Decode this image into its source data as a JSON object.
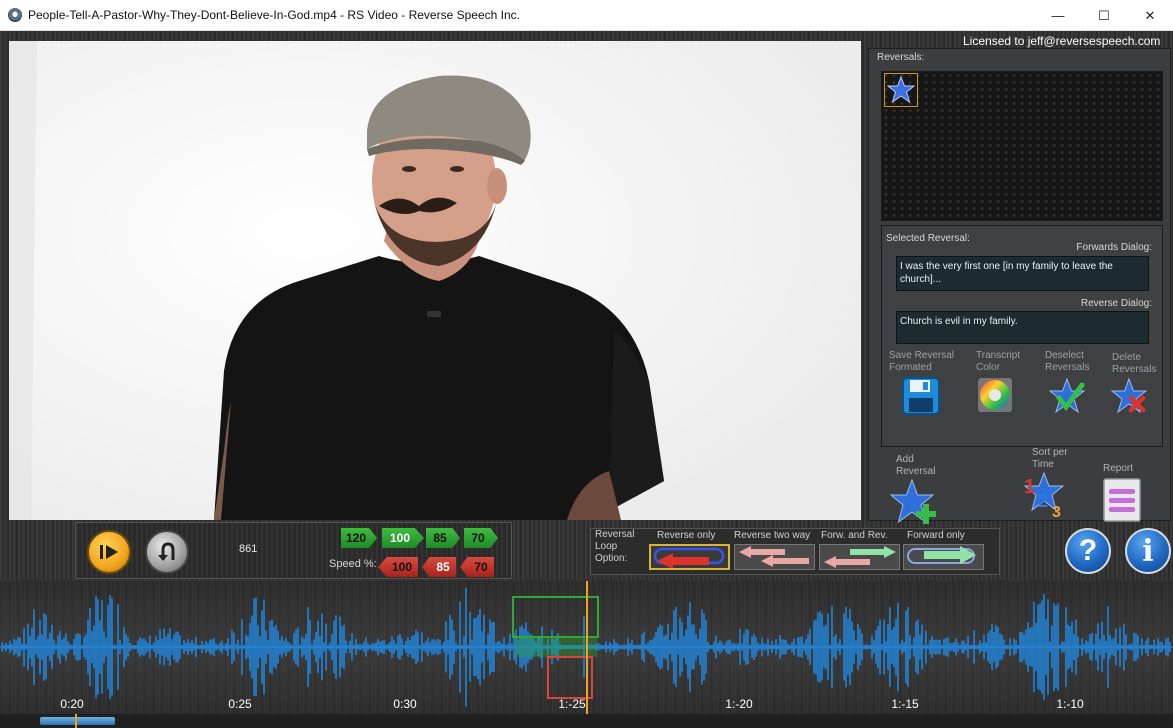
{
  "window": {
    "title": "People-Tell-A-Pastor-Why-They-Dont-Believe-In-God.mp4 - RS Video - Reverse Speech Inc.",
    "minimize": "—",
    "maximize": "☐",
    "close": "✕"
  },
  "license": "Licensed to jeff@reversespeech.com",
  "reversals": {
    "label": "Reversals:"
  },
  "selected": {
    "label": "Selected Reversal:",
    "forward_label": "Forwards Dialog:",
    "forward_text": "I was the very first one [in my family to leave the church]...",
    "reverse_label": "Reverse Dialog:",
    "reverse_text": "Church is evil in my family."
  },
  "tools": {
    "save": "Save Reversal Formated",
    "transcript": "Transcript Color",
    "deselect": "Deselect Reversals",
    "delete": "Delete Reversals",
    "add": "Add Reversal",
    "sort": "Sort per Time",
    "report": "Report"
  },
  "player": {
    "counter": "861",
    "speed_label": "Speed %:",
    "forward_speeds": [
      "120",
      "100",
      "85",
      "70"
    ],
    "reverse_speeds": [
      "100",
      "85",
      "70"
    ],
    "active_forward": "100",
    "active_reverse": "85"
  },
  "loop": {
    "label": "Reversal Loop Option:",
    "options": [
      "Reverse only",
      "Reverse two way",
      "Forw. and Rev.",
      "Forward only"
    ],
    "selected": "Reverse only"
  },
  "help": "?",
  "info": "i",
  "timeline": {
    "labels": [
      "0:20",
      "0:25",
      "0:30",
      "1:-25",
      "1:-20",
      "1:-15",
      "1:-10"
    ],
    "wave_color": "#1e8ff0",
    "cursor_color": "#f2a31b"
  },
  "colors": {
    "active_speed": "#1e8b27",
    "reverse_speed": "#a5231d",
    "selection_green": "#2faa2f",
    "selection_red": "#d9463c"
  }
}
